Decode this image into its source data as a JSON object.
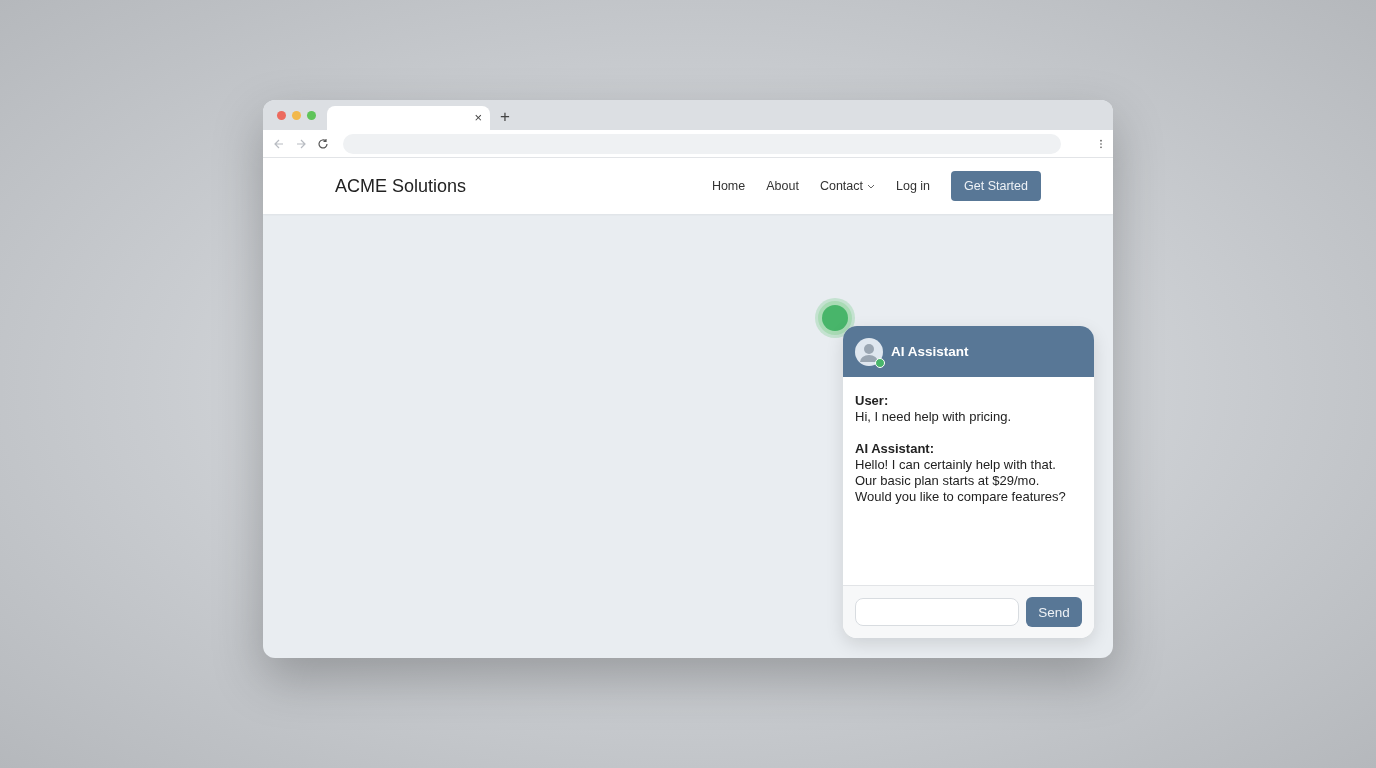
{
  "browser": {
    "tab": {
      "close": "×"
    },
    "new_tab": "+"
  },
  "site": {
    "logo": "ACME Solutions",
    "nav": [
      {
        "label": "Home",
        "has_dropdown": false
      },
      {
        "label": "About",
        "has_dropdown": false
      },
      {
        "label": "Contact",
        "has_dropdown": true
      },
      {
        "label": "Log in",
        "has_dropdown": false
      }
    ],
    "cta": "Get Started"
  },
  "chat": {
    "title": "AI Assistant",
    "online": true,
    "messages": [
      {
        "sender": "User:",
        "text": "Hi, I need help with pricing."
      },
      {
        "sender": "AI Assistant:",
        "text": "Hello! I can certainly help with that. Our basic plan starts at $29/mo. Would you like to compare features?"
      }
    ],
    "send": "Send"
  }
}
